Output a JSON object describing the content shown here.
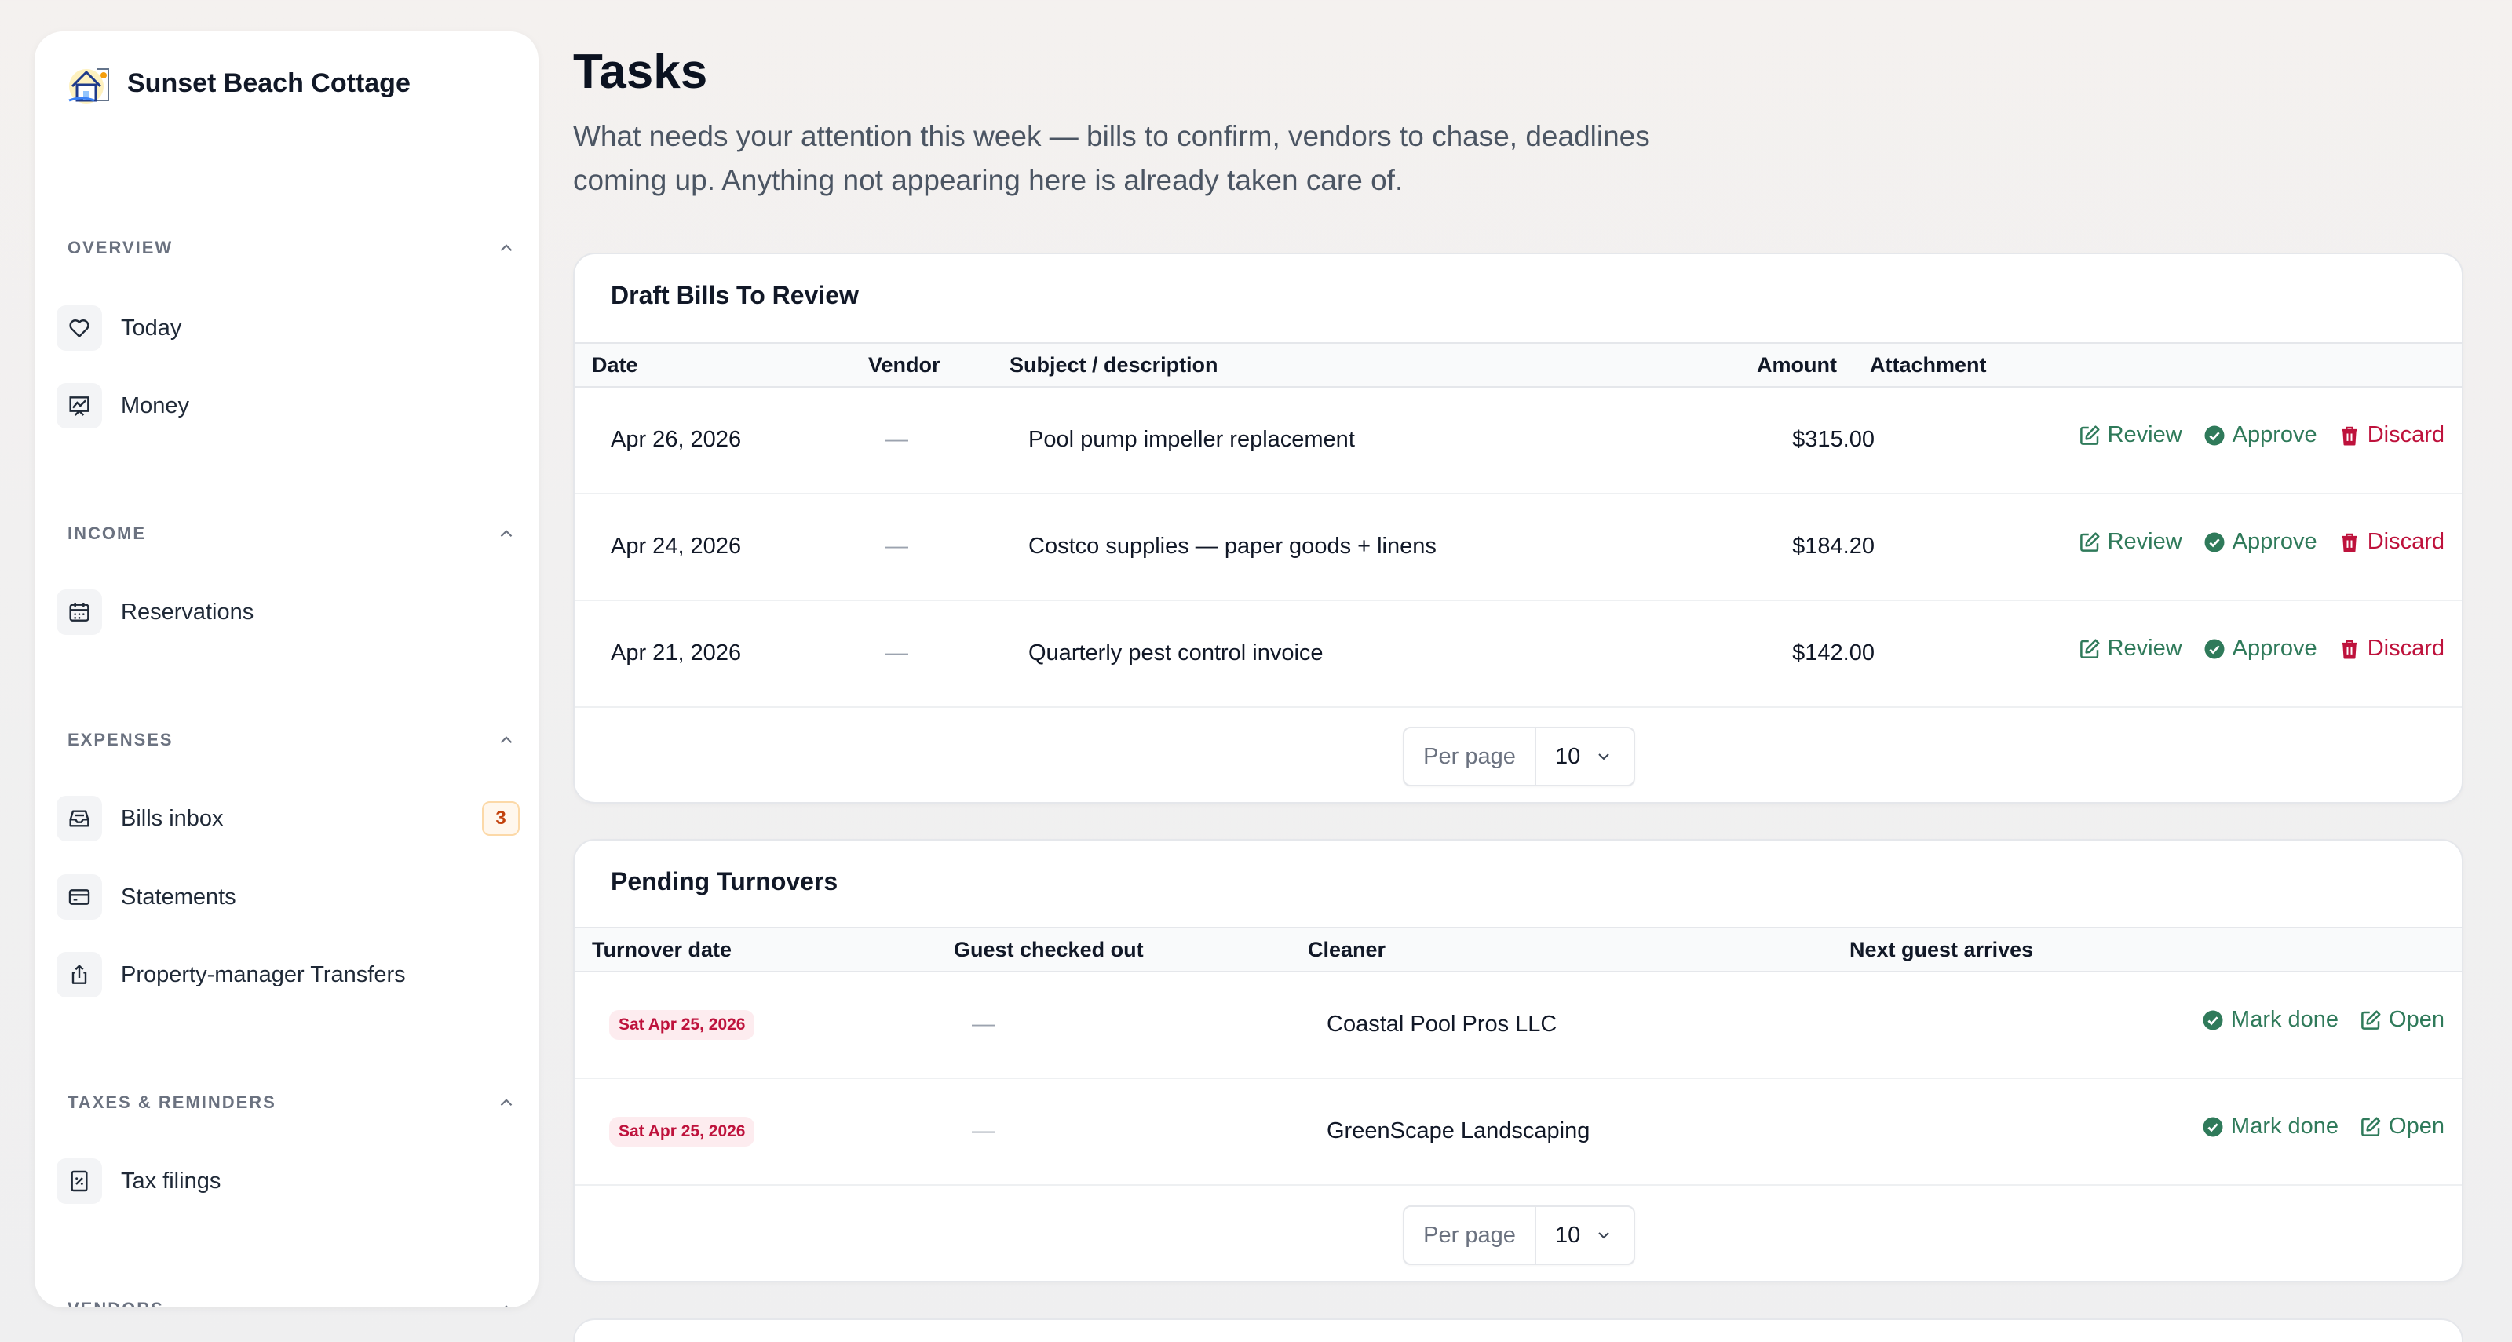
{
  "app": {
    "property_name": "Sunset Beach Cottage"
  },
  "sidebar": {
    "sections": [
      {
        "title": "OVERVIEW",
        "items": [
          {
            "label": "Today",
            "icon": "heart-icon"
          },
          {
            "label": "Money",
            "icon": "chart-icon"
          }
        ]
      },
      {
        "title": "INCOME",
        "items": [
          {
            "label": "Reservations",
            "icon": "calendar-icon"
          }
        ]
      },
      {
        "title": "EXPENSES",
        "items": [
          {
            "label": "Bills inbox",
            "icon": "inbox-icon",
            "badge": "3"
          },
          {
            "label": "Statements",
            "icon": "credit-card-icon"
          },
          {
            "label": "Property-manager Transfers",
            "icon": "share-icon"
          }
        ]
      },
      {
        "title": "TAXES & REMINDERS",
        "items": [
          {
            "label": "Tax filings",
            "icon": "receipt-icon"
          }
        ]
      },
      {
        "title": "VENDORS",
        "items": []
      }
    ]
  },
  "main": {
    "title": "Tasks",
    "subtitle": "What needs your attention this week — bills to confirm, vendors to chase, deadlines coming up. Anything not appearing here is already taken care of."
  },
  "draft_bills": {
    "title": "Draft Bills To Review",
    "columns": [
      "Date",
      "Vendor",
      "Subject / description",
      "Amount",
      "Attachment"
    ],
    "rows": [
      {
        "date": "Apr 26, 2026",
        "vendor": "—",
        "subject": "Pool pump impeller replacement",
        "amount": "$315.00"
      },
      {
        "date": "Apr 24, 2026",
        "vendor": "—",
        "subject": "Costco supplies — paper goods + linens",
        "amount": "$184.20"
      },
      {
        "date": "Apr 21, 2026",
        "vendor": "—",
        "subject": "Quarterly pest control invoice",
        "amount": "$142.00"
      }
    ],
    "actions": {
      "review": "Review",
      "approve": "Approve",
      "discard": "Discard"
    },
    "pager": {
      "label": "Per page",
      "value": "10"
    }
  },
  "turnovers": {
    "title": "Pending Turnovers",
    "columns": [
      "Turnover date",
      "Guest checked out",
      "Cleaner",
      "Next guest arrives"
    ],
    "rows": [
      {
        "date": "Sat Apr 25, 2026",
        "guest": "—",
        "cleaner": "Coastal Pool Pros LLC",
        "next": ""
      },
      {
        "date": "Sat Apr 25, 2026",
        "guest": "—",
        "cleaner": "GreenScape Landscaping",
        "next": ""
      }
    ],
    "actions": {
      "mark_done": "Mark done",
      "open": "Open"
    },
    "pager": {
      "label": "Per page",
      "value": "10"
    }
  },
  "colors": {
    "accent_green": "#2f7a5a",
    "danger_red": "#be123c",
    "badge_orange": "#c2410c"
  }
}
